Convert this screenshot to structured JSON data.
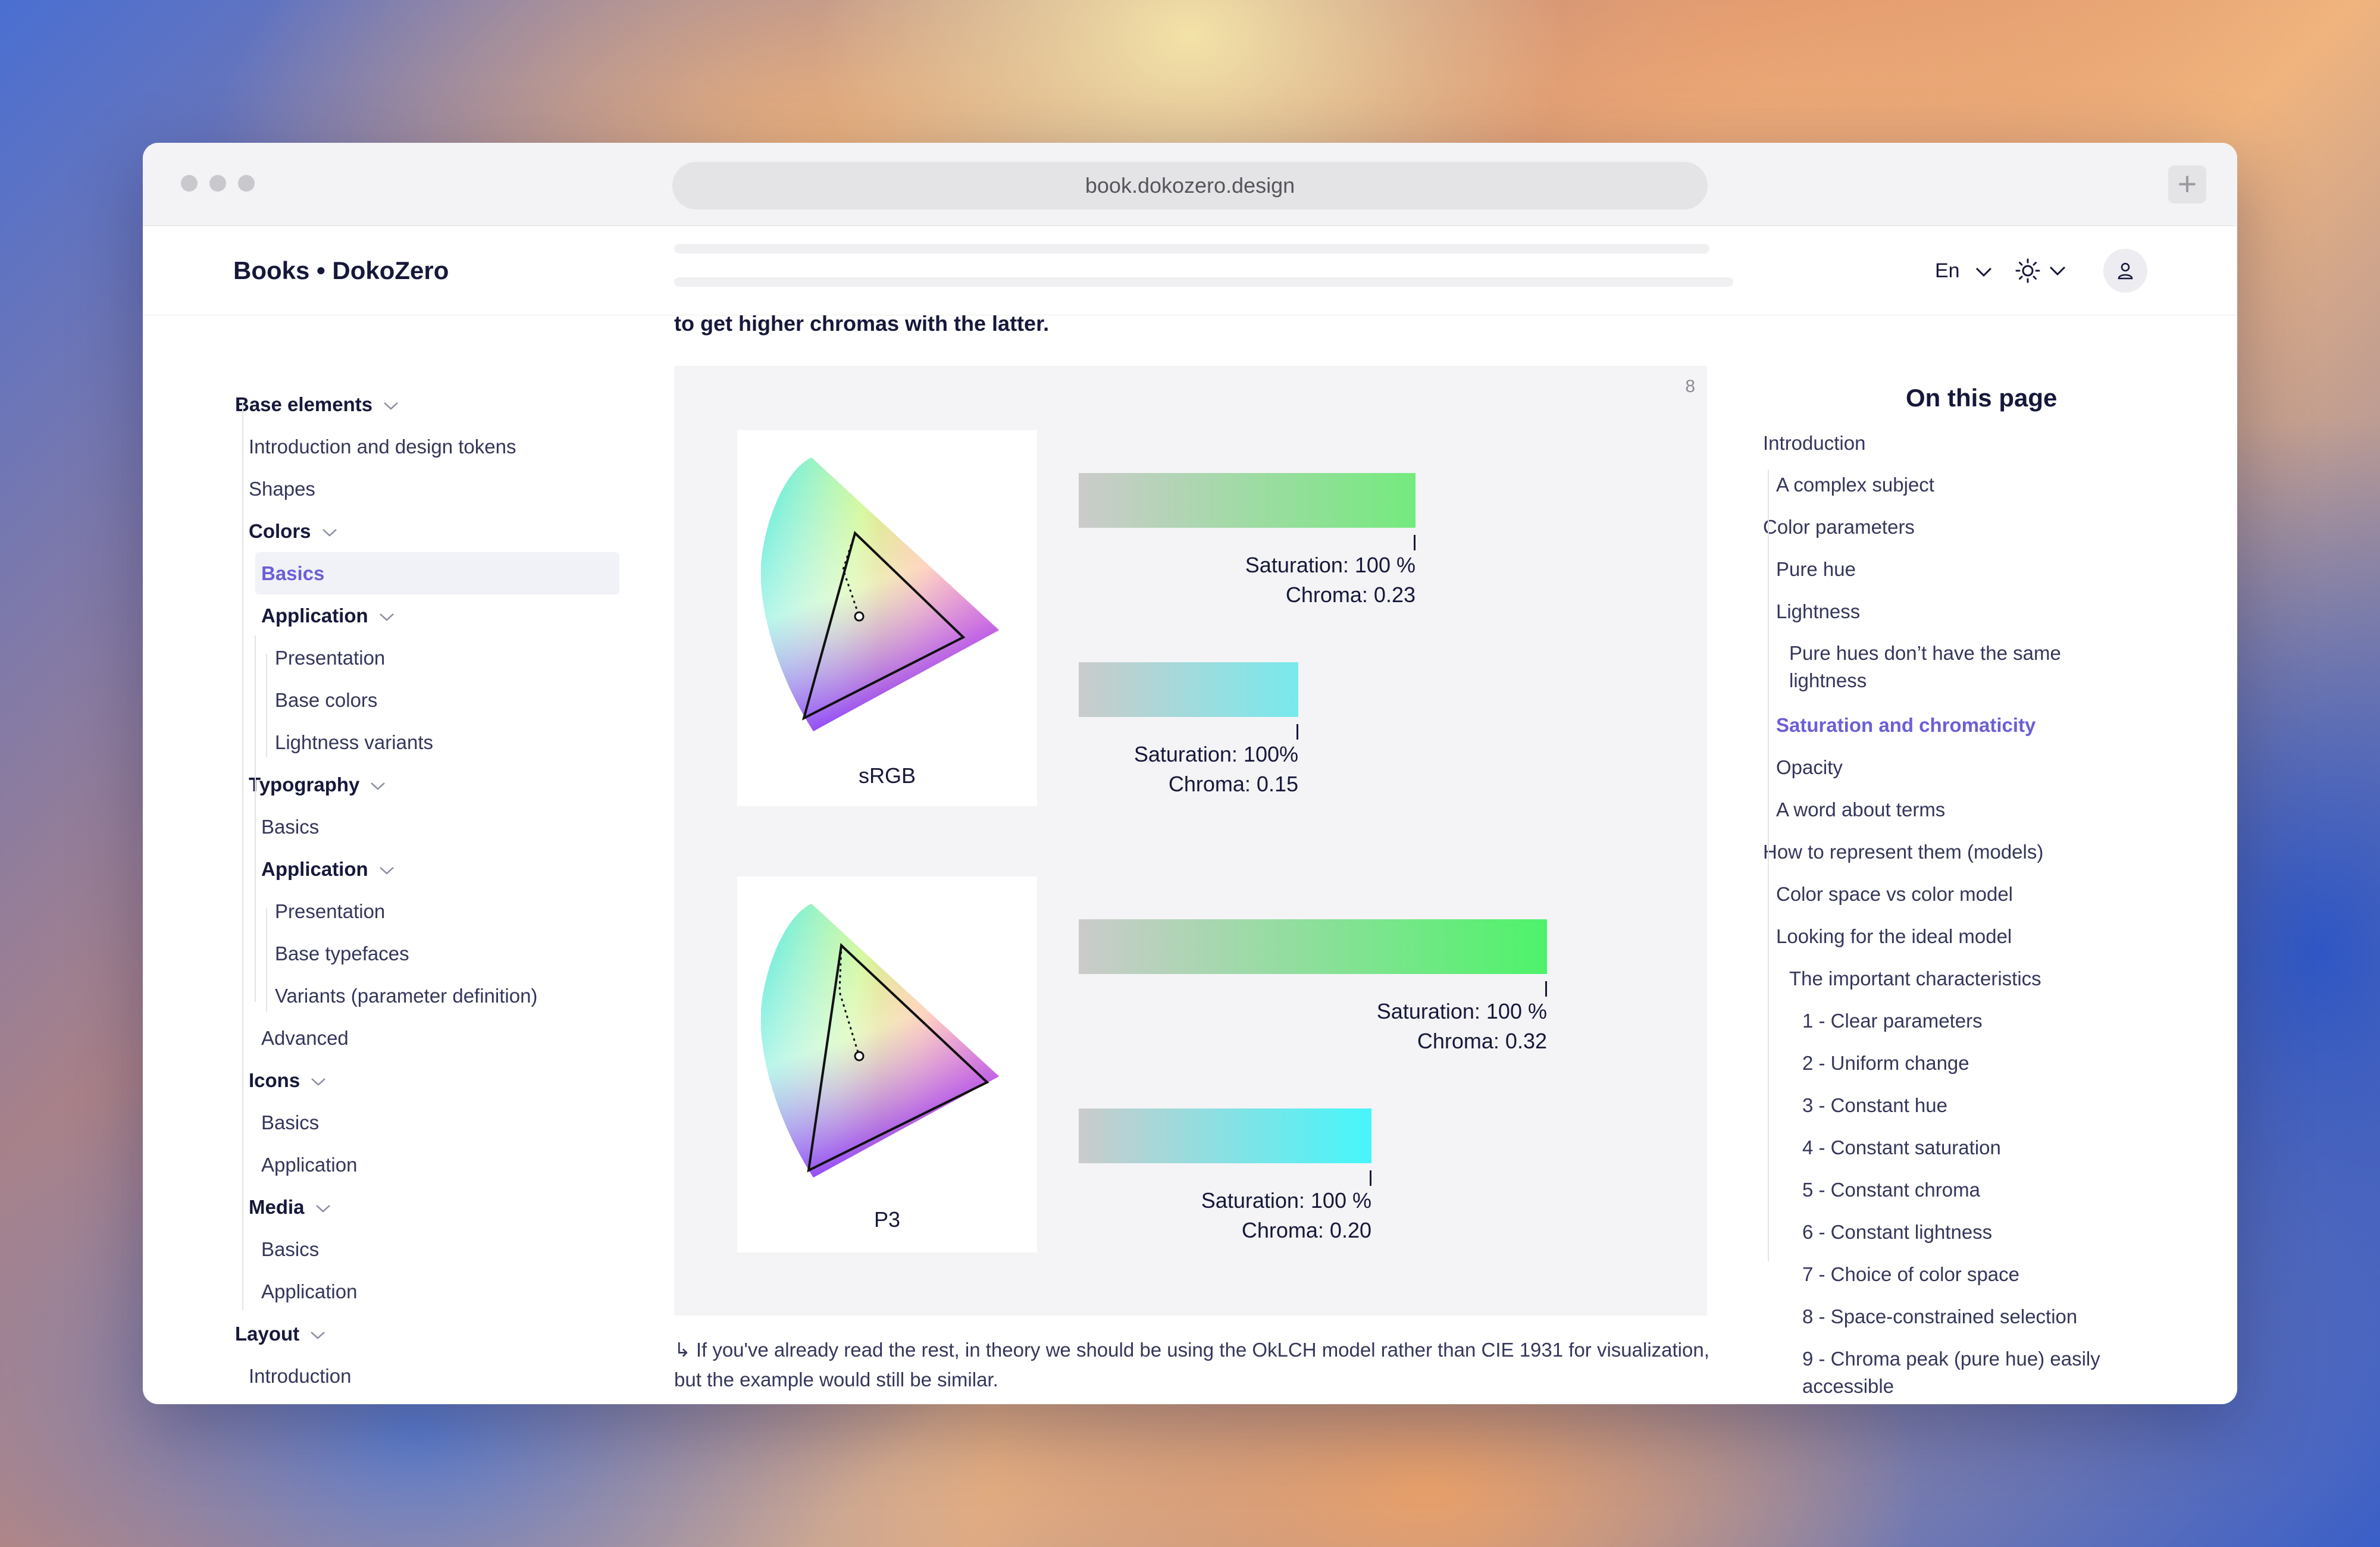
{
  "browser": {
    "url": "book.dokozero.design",
    "new_tab_icon": "plus-icon"
  },
  "header": {
    "logo": "Books • DokoZero",
    "language": "En",
    "theme_icon": "sun-icon",
    "account_icon": "user-icon"
  },
  "content": {
    "behind_header_text": "to get higher chromas with the latter.",
    "figure_number": "8",
    "gamuts": [
      {
        "label": "sRGB",
        "bars": [
          {
            "saturation": "Saturation: 100 %",
            "chroma": "Chroma: 0.23",
            "color": "#74ea7e",
            "chroma_value": 0.23
          },
          {
            "saturation": "Saturation: 100%",
            "chroma": "Chroma: 0.15",
            "color": "#78e9ec",
            "chroma_value": 0.15
          }
        ]
      },
      {
        "label": "P3",
        "bars": [
          {
            "saturation": "Saturation: 100 %",
            "chroma": "Chroma: 0.32",
            "color": "#4ef36a",
            "chroma_value": 0.32
          },
          {
            "saturation": "Saturation: 100 %",
            "chroma": "Chroma: 0.20",
            "color": "#45f6fb",
            "chroma_value": 0.2
          }
        ]
      }
    ],
    "caption": "↳ If you've already read the rest, in theory we should be using the OkLCH model rather than CIE 1931 for visualization, but the example would still be similar."
  },
  "left_nav": {
    "items": [
      {
        "label": "Base elements",
        "heading": true,
        "chevron": true
      },
      {
        "label": "Introduction and design tokens"
      },
      {
        "label": "Shapes"
      },
      {
        "label": "Colors",
        "heading": true,
        "chevron": true
      },
      {
        "label": "Basics",
        "active": true
      },
      {
        "label": "Application",
        "heading": true,
        "chevron": true
      },
      {
        "label": "Presentation"
      },
      {
        "label": "Base colors"
      },
      {
        "label": "Lightness variants"
      },
      {
        "label": "Typography",
        "heading": true,
        "chevron": true
      },
      {
        "label": "Basics"
      },
      {
        "label": "Application",
        "heading": true,
        "chevron": true
      },
      {
        "label": "Presentation"
      },
      {
        "label": "Base typefaces"
      },
      {
        "label": "Variants (parameter definition)"
      },
      {
        "label": "Advanced"
      },
      {
        "label": "Icons",
        "heading": true,
        "chevron": true
      },
      {
        "label": "Basics"
      },
      {
        "label": "Application"
      },
      {
        "label": "Media",
        "heading": true,
        "chevron": true
      },
      {
        "label": "Basics"
      },
      {
        "label": "Application"
      },
      {
        "label": "Layout",
        "heading": true,
        "chevron": true
      },
      {
        "label": "Introduction"
      }
    ]
  },
  "toc": {
    "title": "On this page",
    "items": [
      {
        "label": "Introduction"
      },
      {
        "label": "A complex subject"
      },
      {
        "label": "Color parameters"
      },
      {
        "label": "Pure hue"
      },
      {
        "label": "Lightness"
      },
      {
        "label": "Pure hues don’t have the same"
      },
      {
        "label": "lightness"
      },
      {
        "label": "Saturation and chromaticity",
        "active": true
      },
      {
        "label": "Opacity"
      },
      {
        "label": "A word about terms"
      },
      {
        "label": "How to represent them (models)"
      },
      {
        "label": "Color space vs color model"
      },
      {
        "label": "Looking for the ideal model"
      },
      {
        "label": "The important characteristics"
      },
      {
        "label": "1 - Clear parameters"
      },
      {
        "label": "2 - Uniform change"
      },
      {
        "label": "3 - Constant hue"
      },
      {
        "label": "4 - Constant saturation"
      },
      {
        "label": "5 - Constant chroma"
      },
      {
        "label": "6 - Constant lightness"
      },
      {
        "label": "7 - Choice of color space"
      },
      {
        "label": "8 - Space-constrained selection"
      },
      {
        "label": "9 - Chroma peak (pure hue) easily"
      },
      {
        "label": "accessible"
      }
    ]
  }
}
